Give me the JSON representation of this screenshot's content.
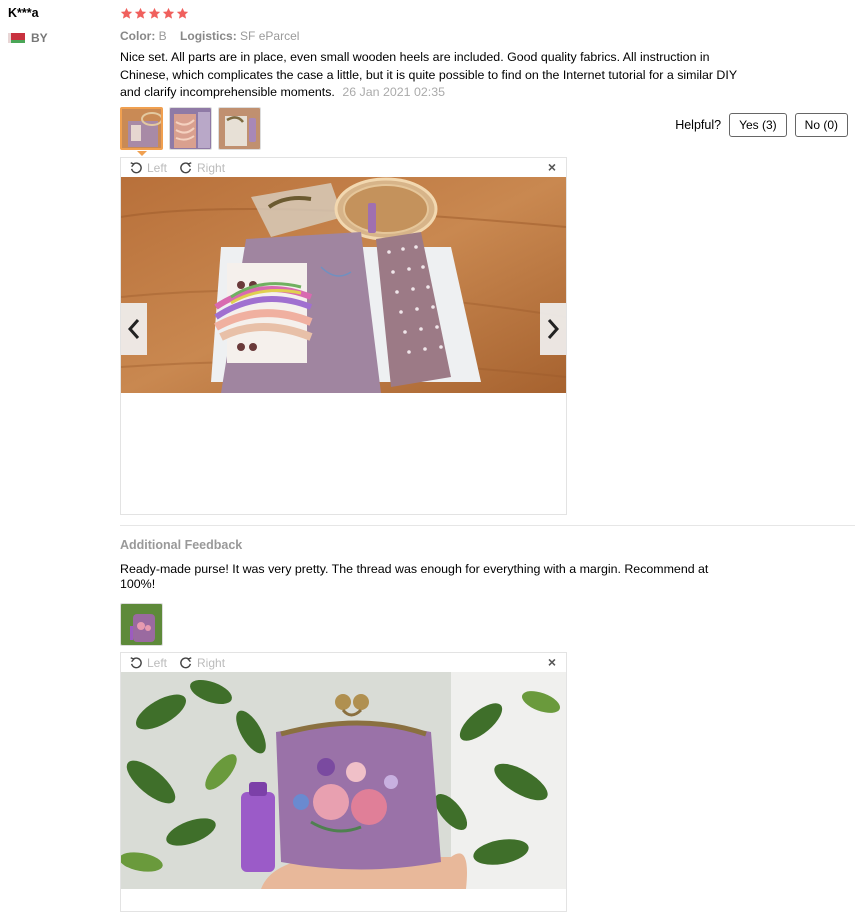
{
  "reviewer": {
    "name": "K***a",
    "country": "BY",
    "rating_stars": 5,
    "star_color": "#f0605d"
  },
  "meta": {
    "color_label": "Color:",
    "color_value": "B",
    "logistics_label": "Logistics:",
    "logistics_value": "SF eParcel"
  },
  "review": {
    "text": "Nice set. All parts are in place, even small wooden heels are included. Good quality fabrics. All instruction in Chinese, which complicates the case a little, but it is quite possible to find on the Internet tutorial for a similar DIY and clarify incomprehensible moments.",
    "date": "26 Jan 2021 02:35",
    "thumbnails": [
      "kit-photo-1",
      "kit-photo-2",
      "kit-photo-3"
    ]
  },
  "helpful": {
    "label": "Helpful?",
    "yes_label": "Yes (3)",
    "no_label": "No (0)"
  },
  "viewer": {
    "rotate_left": "Left",
    "rotate_right": "Right",
    "close": "×"
  },
  "additional": {
    "title": "Additional Feedback",
    "text": "Ready-made purse! It was very pretty. The thread was enough for everything with a margin. Recommend at 100%!",
    "thumbnails": [
      "purse-photo-1"
    ]
  },
  "colors": {
    "accent_border": "#f0a050",
    "muted_text": "#999999",
    "divider": "#e6e6e6"
  }
}
